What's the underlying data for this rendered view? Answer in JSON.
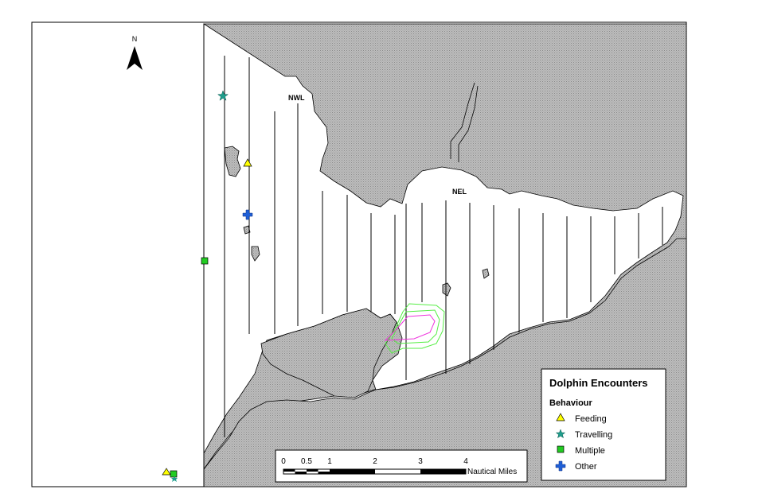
{
  "map": {
    "north_label": "N",
    "place_labels": [
      {
        "id": "nwl",
        "text": "NWL"
      },
      {
        "id": "nel",
        "text": "NEL"
      }
    ],
    "colors": {
      "land": "#c0c0c0",
      "water": "#ffffff",
      "outline": "#000000",
      "transect": "#000000",
      "zone_outer": "#55ee44",
      "zone_inner": "#ee33dd"
    }
  },
  "legend": {
    "title": "Dolphin Encounters",
    "subtitle": "Behaviour",
    "items": [
      {
        "label": "Feeding",
        "symbol": "triangle-icon",
        "color": "#ffff00"
      },
      {
        "label": "Travelling",
        "symbol": "star-icon",
        "color": "#1e9e8c"
      },
      {
        "label": "Multiple",
        "symbol": "square-icon",
        "color": "#22cc22"
      },
      {
        "label": "Other",
        "symbol": "plus-icon",
        "color": "#1f5fd6"
      }
    ]
  },
  "scalebar": {
    "ticks": [
      "0",
      "0.5",
      "1",
      "2",
      "3",
      "4"
    ],
    "unit": "Nautical Miles"
  }
}
